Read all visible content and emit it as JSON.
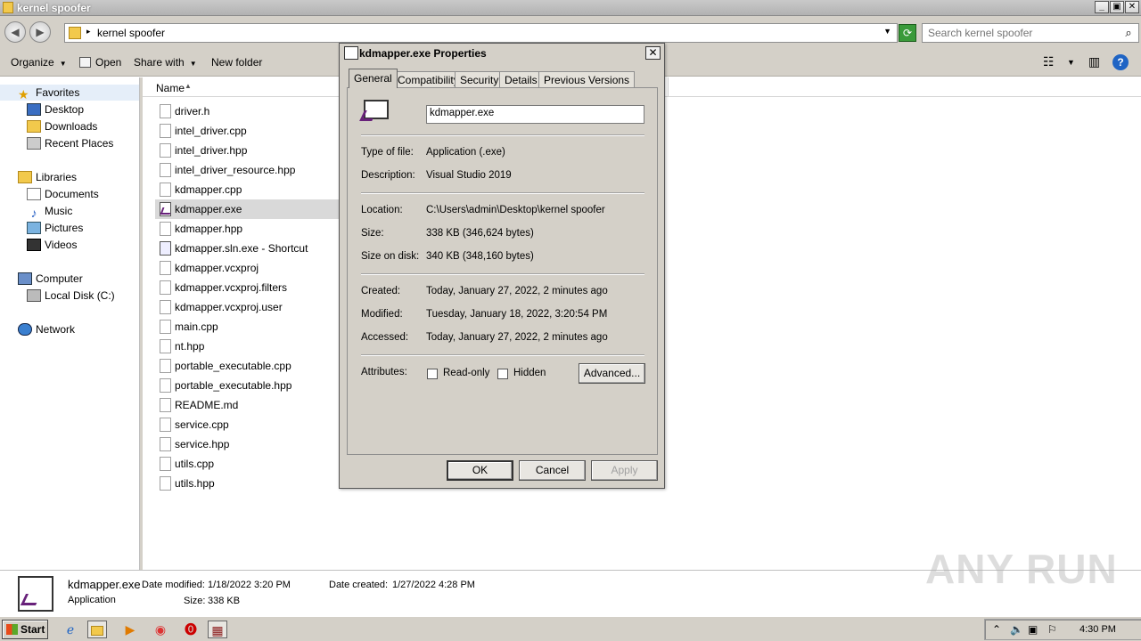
{
  "window": {
    "title": "kernel spoofer",
    "minimize": "_",
    "restore": "▣",
    "close": "✕"
  },
  "address": {
    "path": "kernel spoofer",
    "search_placeholder": "Search kernel spoofer"
  },
  "toolbar": {
    "organize": "Organize",
    "open": "Open",
    "share_with": "Share with",
    "new_folder": "New folder"
  },
  "nav": {
    "favorites": "Favorites",
    "desktop": "Desktop",
    "downloads": "Downloads",
    "recent_places": "Recent Places",
    "libraries": "Libraries",
    "documents": "Documents",
    "music": "Music",
    "pictures": "Pictures",
    "videos": "Videos",
    "computer": "Computer",
    "local_disk": "Local Disk (C:)",
    "network": "Network"
  },
  "filelist": {
    "col_name": "Name",
    "files": [
      "driver.h",
      "intel_driver.cpp",
      "intel_driver.hpp",
      "intel_driver_resource.hpp",
      "kdmapper.cpp",
      "kdmapper.exe",
      "kdmapper.hpp",
      "kdmapper.sln.exe - Shortcut",
      "kdmapper.vcxproj",
      "kdmapper.vcxproj.filters",
      "kdmapper.vcxproj.user",
      "main.cpp",
      "nt.hpp",
      "portable_executable.cpp",
      "portable_executable.hpp",
      "README.md",
      "service.cpp",
      "service.hpp",
      "utils.cpp",
      "utils.hpp"
    ]
  },
  "details": {
    "filename": "kdmapper.exe",
    "type": "Application",
    "date_modified_label": "Date modified:",
    "date_modified": "1/18/2022 3:20 PM",
    "date_created_label": "Date created:",
    "date_created": "1/27/2022 4:28 PM",
    "size_label": "Size:",
    "size": "338 KB"
  },
  "watermark": "ANY RUN",
  "dialog": {
    "title": "kdmapper.exe Properties",
    "tabs": [
      "General",
      "Compatibility",
      "Security",
      "Details",
      "Previous Versions"
    ],
    "filename": "kdmapper.exe",
    "type_label": "Type of file:",
    "type_value": "Application (.exe)",
    "desc_label": "Description:",
    "desc_value": "Visual Studio 2019",
    "location_label": "Location:",
    "location_value": "C:\\Users\\admin\\Desktop\\kernel spoofer",
    "size_label": "Size:",
    "size_value": "338 KB (346,624 bytes)",
    "size_disk_label": "Size on disk:",
    "size_disk_value": "340 KB (348,160 bytes)",
    "created_label": "Created:",
    "created_value": "Today, January 27, 2022, 2 minutes ago",
    "modified_label": "Modified:",
    "modified_value": "Tuesday, January 18, 2022, 3:20:54 PM",
    "accessed_label": "Accessed:",
    "accessed_value": "Today, January 27, 2022, 2 minutes ago",
    "attributes_label": "Attributes:",
    "readonly_label": "Read-only",
    "hidden_label": "Hidden",
    "advanced_label": "Advanced...",
    "ok_label": "OK",
    "cancel_label": "Cancel",
    "apply_label": "Apply"
  },
  "taskbar": {
    "start_label": "Start",
    "clock": "4:30 PM"
  }
}
